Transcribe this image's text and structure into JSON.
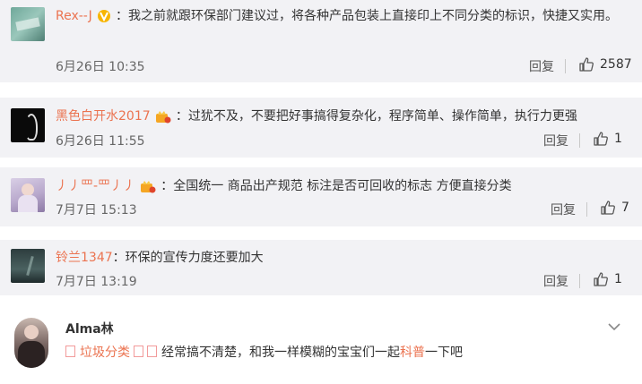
{
  "comments": [
    {
      "user": "Rex--J",
      "sep": "：",
      "text": "我之前就跟环保部门建议过，将各种产品包装上直接印上不同分类的标识，快捷又实用。",
      "time": "6月26日 10:35",
      "reply": "回复",
      "likes": "2587"
    },
    {
      "user": "黑色白开水2017",
      "sep": "：",
      "text": "过犹不及，不要把好事搞得复杂化，程序简单、操作简单，执行力更强",
      "time": "6月26日 11:55",
      "reply": "回复",
      "likes": "1"
    },
    {
      "user": "丿丿罒-罒丿丿",
      "sep": "：",
      "text": "全国统一  商品出产规范 标注是否可回收的标志 方便直接分类",
      "time": "7月7日 15:13",
      "reply": "回复",
      "likes": "7"
    },
    {
      "user": "铃兰1347",
      "sep": "：",
      "text": "环保的宣传力度还要加大",
      "time": "7月7日 13:19",
      "reply": "回复",
      "likes": "1"
    }
  ],
  "post": {
    "user": "Alma林",
    "seg1": "垃圾分类",
    "seg2": "经常搞不清楚，和我一样模糊的宝宝们一起",
    "seg3": "科普",
    "seg4": "一下吧"
  },
  "colors": {
    "username": "#eb7350",
    "card_bg": "#f2f2f5",
    "vip_gold": "#f7b500"
  }
}
